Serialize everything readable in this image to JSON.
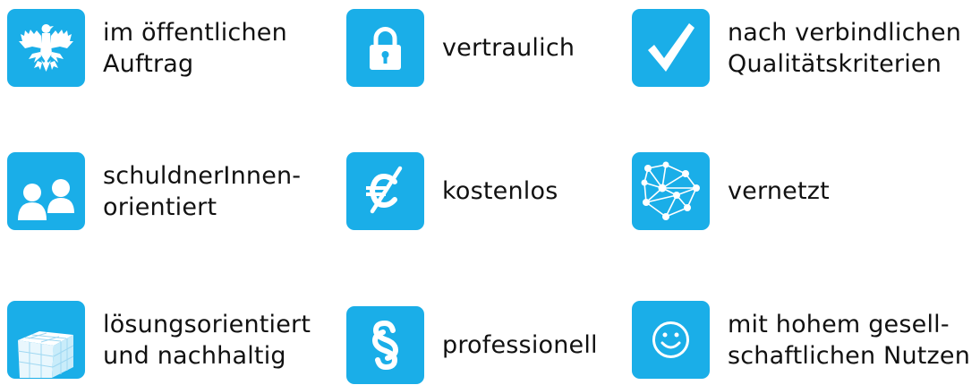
{
  "accent_color": "#1aaee8",
  "features": [
    {
      "icon": "eagle-icon",
      "lines": [
        "im öffentlichen",
        "Auftrag"
      ]
    },
    {
      "icon": "padlock-icon",
      "lines": [
        "vertraulich"
      ]
    },
    {
      "icon": "checkmark-icon",
      "lines": [
        "nach verbindlichen",
        "Qualitätskriterien"
      ]
    },
    {
      "icon": "people-icon",
      "lines": [
        "schuldnerInnen-",
        "orientiert"
      ]
    },
    {
      "icon": "crossed-euro-icon",
      "lines": [
        "kostenlos"
      ]
    },
    {
      "icon": "network-icon",
      "lines": [
        "vernetzt"
      ]
    },
    {
      "icon": "cube-icon",
      "lines": [
        "lösungsorientiert",
        "und nachhaltig"
      ]
    },
    {
      "icon": "paragraph-icon",
      "lines": [
        "professionell"
      ]
    },
    {
      "icon": "smiley-icon",
      "lines": [
        "mit hohem gesell-",
        "schaftlichen Nutzen"
      ]
    }
  ]
}
